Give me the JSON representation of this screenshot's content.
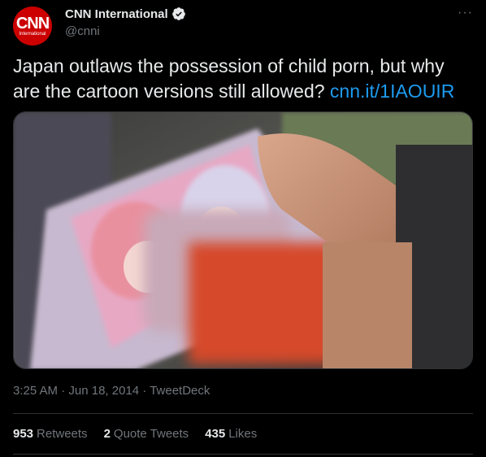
{
  "author": {
    "display_name": "CNN International",
    "handle": "@cnni",
    "avatar_text": "CNN",
    "avatar_subtext": "International",
    "verified_icon": "verified-badge-icon"
  },
  "more_label": "···",
  "tweet": {
    "text": "Japan outlaws the possession of child porn, but why are the cartoon versions still allowed? ",
    "link": "cnn.it/1IAOUIR"
  },
  "meta": {
    "time": "3:25 AM",
    "separator": " · ",
    "date": "Jun 18, 2014",
    "source": "TweetDeck"
  },
  "stats": [
    {
      "count": "953",
      "label": "Retweets"
    },
    {
      "count": "2",
      "label": "Quote Tweets"
    },
    {
      "count": "435",
      "label": "Likes"
    }
  ],
  "colors": {
    "background": "#000000",
    "text": "#e7e9ea",
    "secondary": "#71767b",
    "link": "#1d9bf0",
    "brand": "#cc0000"
  }
}
